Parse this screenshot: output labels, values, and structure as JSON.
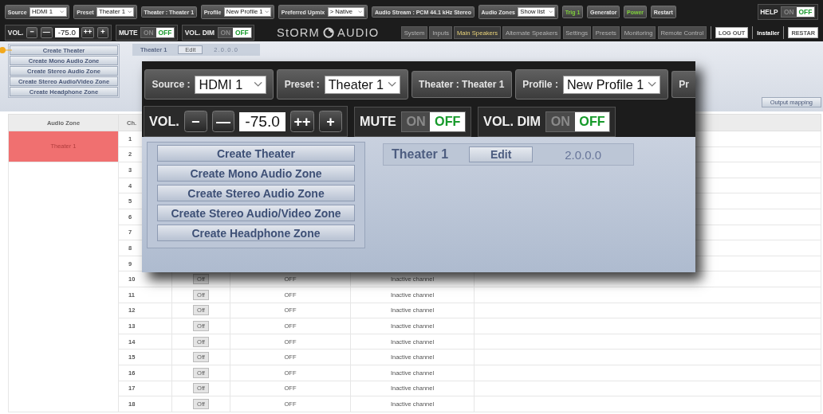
{
  "top_bar": {
    "controls": [
      {
        "kind": "select",
        "label": "Source",
        "value": "HDMI 1"
      },
      {
        "kind": "select",
        "label": "Preset",
        "value": "Theater 1"
      },
      {
        "kind": "display",
        "label": "Theater : Theater 1"
      },
      {
        "kind": "select",
        "label": "Profile",
        "value": "New Profile 1"
      },
      {
        "kind": "select",
        "label": "Preferred Upmix",
        "value": "> Native"
      },
      {
        "kind": "display",
        "label": "Audio Stream : PCM 44.1 kHz Stereo"
      },
      {
        "kind": "select",
        "label": "Audio Zones",
        "value": "Show list"
      },
      {
        "kind": "button",
        "label": "Trig 1",
        "active": true
      },
      {
        "kind": "button",
        "label": "Generator",
        "active": false
      },
      {
        "kind": "button",
        "label": "Power",
        "active": true
      },
      {
        "kind": "button",
        "label": "Restart",
        "active": false
      }
    ],
    "help": {
      "label": "HELP",
      "on_label": "ON",
      "off_label": "OFF",
      "on": false
    },
    "volume": {
      "label": "VOL.",
      "minus": [
        "−",
        "—"
      ],
      "value": "-75.0",
      "plus": [
        "++",
        "+"
      ]
    },
    "toggles": [
      {
        "label": "MUTE",
        "on_label": "ON",
        "off_label": "OFF",
        "on": false
      },
      {
        "label": "VOL. DIM",
        "on_label": "ON",
        "off_label": "OFF",
        "on": false
      }
    ],
    "logo": {
      "left": "StORM",
      "right": "AUDIO"
    },
    "tabs": [
      {
        "label": "System",
        "selected": false
      },
      {
        "label": "Inputs",
        "selected": false
      },
      {
        "label": "Main Speakers",
        "selected": true
      },
      {
        "label": "Alternate Speakers",
        "selected": false
      },
      {
        "label": "Settings",
        "selected": false
      },
      {
        "label": "Presets",
        "selected": false
      },
      {
        "label": "Monitoring",
        "selected": false
      },
      {
        "label": "Remote Control",
        "selected": false
      }
    ],
    "actions": [
      {
        "kind": "button",
        "label": "LOG OUT"
      },
      {
        "kind": "link",
        "label": "Installer"
      },
      {
        "kind": "button",
        "label": "RESTAR"
      }
    ]
  },
  "zone_buttons": [
    "Create Theater",
    "Create Mono Audio Zone",
    "Create Stereo Audio Zone",
    "Create Stereo Audio/Video Zone",
    "Create Headphone Zone"
  ],
  "zone_header": {
    "name": "Theater 1",
    "edit": "Edit",
    "version": "2.0.0.0"
  },
  "output_mapping": "Output mapping",
  "table": {
    "columns": [
      "Audio Zone",
      "Ch."
    ],
    "zones": [
      {
        "label": "Theater 1",
        "color": "#f07070",
        "rows": [
          {
            "ch": "1"
          },
          {
            "ch": "2"
          }
        ]
      },
      {
        "rows": [
          {
            "ch": "3"
          },
          {
            "ch": "4"
          },
          {
            "ch": "5"
          },
          {
            "ch": "6"
          },
          {
            "ch": "7"
          },
          {
            "ch": "8"
          },
          {
            "ch": "9"
          },
          {
            "ch": "10",
            "switch": "Off",
            "on": false,
            "state": "OFF",
            "status": "Inactive channel"
          },
          {
            "ch": "11",
            "switch": "Off",
            "on": false,
            "state": "OFF",
            "status": "Inactive channel"
          },
          {
            "ch": "12",
            "switch": "Off",
            "on": false,
            "state": "OFF",
            "status": "Inactive channel"
          },
          {
            "ch": "13",
            "switch": "Off",
            "on": false,
            "state": "OFF",
            "status": "Inactive channel"
          },
          {
            "ch": "14",
            "switch": "Off",
            "on": false,
            "state": "OFF",
            "status": "Inactive channel"
          },
          {
            "ch": "15",
            "switch": "Off",
            "on": false,
            "state": "OFF",
            "status": "Inactive channel"
          },
          {
            "ch": "16",
            "switch": "Off",
            "on": false,
            "state": "OFF",
            "status": "Inactive channel"
          },
          {
            "ch": "17",
            "switch": "Off",
            "on": false,
            "state": "OFF",
            "status": "Inactive channel"
          },
          {
            "ch": "18",
            "switch": "Off",
            "on": false,
            "state": "OFF",
            "status": "Inactive channel"
          }
        ]
      }
    ]
  },
  "inset": {
    "top_bar": {
      "controls": [
        {
          "kind": "select",
          "label": "Source :",
          "value": "HDMI 1"
        },
        {
          "kind": "select",
          "label": "Preset :",
          "value": "Theater 1"
        },
        {
          "kind": "display",
          "label": "Theater : Theater 1"
        },
        {
          "kind": "select",
          "label": "Profile :",
          "value": "New Profile 1"
        },
        {
          "kind": "cut",
          "label": "Pr"
        }
      ],
      "volume": {
        "label": "VOL.",
        "minus": [
          "−",
          "—"
        ],
        "value": "-75.0",
        "plus": [
          "++",
          "+"
        ]
      },
      "toggles": [
        {
          "label": "MUTE",
          "on_label": "ON",
          "off_label": "OFF",
          "on": false
        },
        {
          "label": "VOL. DIM",
          "on_label": "ON",
          "off_label": "OFF",
          "on": false
        }
      ]
    },
    "zone_buttons": [
      "Create Theater",
      "Create Mono Audio Zone",
      "Create Stereo Audio Zone",
      "Create Stereo Audio/Video Zone",
      "Create Headphone Zone"
    ],
    "zone_header": {
      "name": "Theater 1",
      "edit": "Edit",
      "version": "2.0.0.0"
    }
  }
}
